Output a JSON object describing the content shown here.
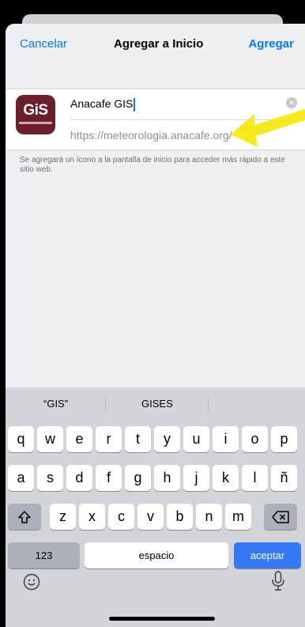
{
  "nav": {
    "cancel_label": "Cancelar",
    "title": "Agregar a Inicio",
    "add_label": "Agregar"
  },
  "app": {
    "icon_text": "GiS",
    "name_value": "Anacafe GIS",
    "url": "https://meteorologia.anacafe.org/"
  },
  "footnote": "Se agregará un ícono a la pantalla de inicio para acceder más rápido a este sitio web.",
  "suggestions": [
    "“GIS”",
    "GISES",
    ""
  ],
  "keyboard": {
    "row1": [
      "q",
      "w",
      "e",
      "r",
      "t",
      "y",
      "u",
      "i",
      "o",
      "p"
    ],
    "row2": [
      "a",
      "s",
      "d",
      "f",
      "g",
      "h",
      "j",
      "k",
      "l",
      "ñ"
    ],
    "row3": [
      "z",
      "x",
      "c",
      "v",
      "b",
      "n",
      "m"
    ],
    "numbers_label": "123",
    "space_label": "espacio",
    "return_label": "aceptar"
  },
  "colors": {
    "accent": "#007aff",
    "return_key": "#3478f6",
    "arrow": "#f5ea1c",
    "icon_bg": "#6b1e2c"
  }
}
